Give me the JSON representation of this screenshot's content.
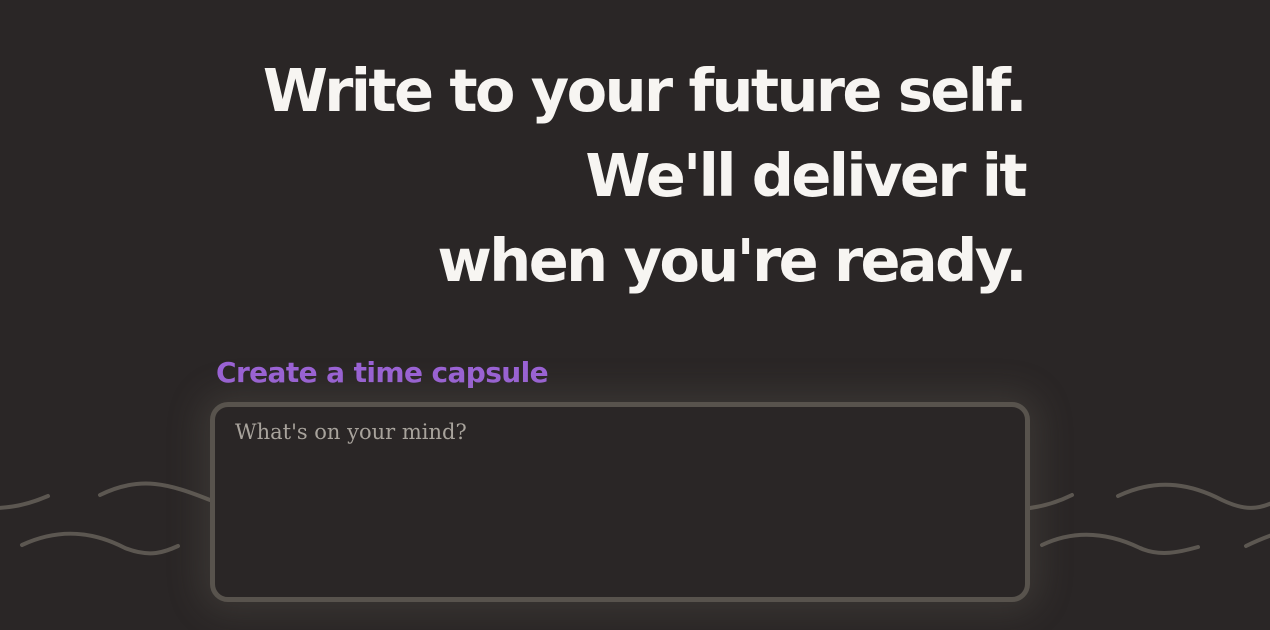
{
  "hero": {
    "line1": "Write to your future self.",
    "line2": "We'll deliver it",
    "line3": "when you're ready."
  },
  "capsule": {
    "heading": "Create a time capsule",
    "placeholder": "What's on your mind?",
    "value": ""
  },
  "colors": {
    "background": "#2a2626",
    "headline": "#f7f5f2",
    "accent": "#9b63d6",
    "box_border": "#58534d",
    "wave": "#5c5751"
  }
}
